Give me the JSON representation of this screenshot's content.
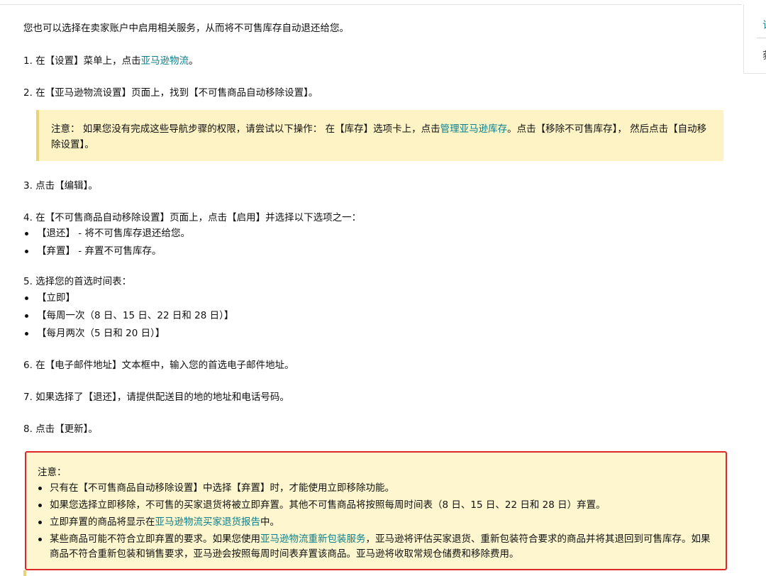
{
  "side": {
    "link1": "订",
    "link2": "获"
  },
  "intro": "您也可以选择在卖家账户中启用相关服务，从而将不可售库存自动退还给您。",
  "step1": {
    "prefix": "1. 在【设置】菜单上，点击",
    "link": "亚马逊物流",
    "suffix": "。"
  },
  "step2": "2. 在【亚马逊物流设置】页面上，找到【不可售商品自动移除设置】。",
  "note1": {
    "prefix": "注意： 如果您没有完成这些导航步骤的权限，请尝试以下操作： 在【库存】选项卡上，点击",
    "link": "管理亚马逊库存",
    "suffix": "。点击【移除不可售库存】， 然后点击【自动移除设置】。"
  },
  "step3": "3. 点击【编辑】。",
  "step4": {
    "text": "4. 在【不可售商品自动移除设置】页面上，点击【启用】并选择以下选项之一：",
    "options": [
      "【退还】 - 将不可售库存退还给您。",
      "【弃置】 - 弃置不可售库存。"
    ]
  },
  "step5": {
    "text": "5. 选择您的首选时间表：",
    "options": [
      "【立即】",
      "【每周一次（8 日、15 日、22 日和 28 日）】",
      "【每月两次（5 日和 20 日）】"
    ]
  },
  "step6": "6. 在【电子邮件地址】文本框中，输入您的首选电子邮件地址。",
  "step7": "7. 如果选择了【退还】，请提供配送目的地的地址和电话号码。",
  "step8": "8. 点击【更新】。",
  "note2": {
    "title": "注意：",
    "b1": "只有在【不可售商品自动移除设置】中选择【弃置】时，才能使用立即移除功能。",
    "b2": "如果您选择立即移除，不可售的买家退货将被立即弃置。其他不可售商品将按照每周时间表（8 日、15 日、22 日和 28 日）弃置。",
    "b3": {
      "prefix": "立即弃置的商品将显示在",
      "link": "亚马逊物流买家退货报告",
      "suffix": "中。"
    },
    "b4": {
      "prefix": "某些商品可能不符合立即弃置的要求。如果您使用",
      "link": "亚马逊物流重新包装服务",
      "suffix": "，亚马逊将评估买家退货、重新包装符合要求的商品并将其退回到可售库存。如果商品不符合重新包装和销售要求，亚马逊会按照每周时间表弃置该商品。亚马逊将收取常规仓储费和移除费用。"
    }
  },
  "colors": {
    "link": "#0b7f8a",
    "note_bg": "#fdf3c4",
    "highlight_border": "#e0262a"
  }
}
